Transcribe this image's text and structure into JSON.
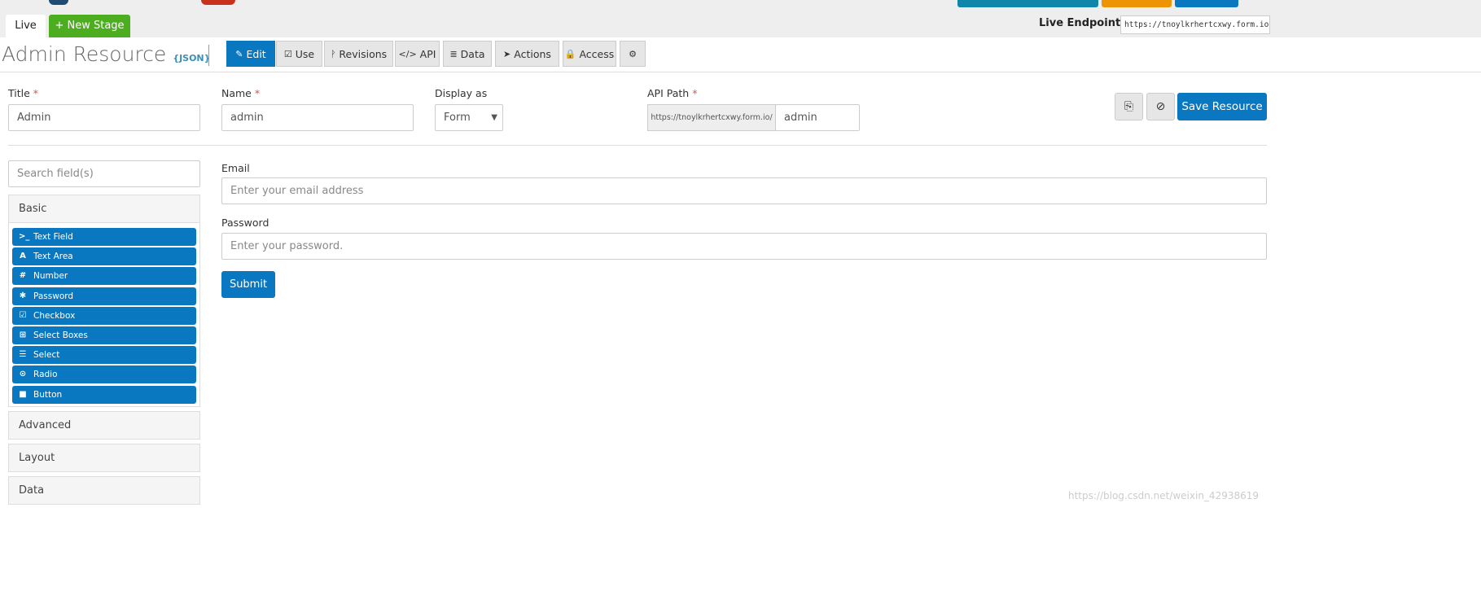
{
  "stage_tabs": {
    "live": "Live",
    "new_stage": "+ New Stage"
  },
  "endpoint": {
    "label": "Live Endpoint:",
    "value": "https://tnoylkrhertcxwy.form.io"
  },
  "header": {
    "title": "Admin Resource",
    "json_badge": "{JSON}"
  },
  "nav": [
    {
      "label": "Edit",
      "icon": "edit-icon",
      "glyph": "✎"
    },
    {
      "label": "Use",
      "icon": "check-square-icon",
      "glyph": "☑"
    },
    {
      "label": "Revisions",
      "icon": "branch-icon",
      "glyph": "ᚹ"
    },
    {
      "label": "API",
      "icon": "code-icon",
      "glyph": "</>"
    },
    {
      "label": "Data",
      "icon": "database-icon",
      "glyph": "≣"
    },
    {
      "label": "Actions",
      "icon": "paper-plane-icon",
      "glyph": "➤"
    },
    {
      "label": "Access",
      "icon": "lock-icon",
      "glyph": "🔒"
    },
    {
      "label": "",
      "icon": "gear-icon",
      "glyph": "⚙"
    }
  ],
  "settings": {
    "title": {
      "label": "Title",
      "value": "Admin"
    },
    "name": {
      "label": "Name",
      "value": "admin"
    },
    "display": {
      "label": "Display as",
      "value": "Form"
    },
    "api_path": {
      "label": "API Path",
      "prefix": "https://tnoylkrhertcxwy.form.io/",
      "value": "admin"
    },
    "required_mark": "*",
    "save_label": "Save Resource"
  },
  "sidebar": {
    "search_placeholder": "Search field(s)",
    "groups": [
      "Basic",
      "Advanced",
      "Layout",
      "Data"
    ],
    "basic_components": [
      {
        "label": "Text Field",
        "icon": "terminal-icon",
        "glyph": ">_"
      },
      {
        "label": "Text Area",
        "icon": "font-icon",
        "glyph": "A"
      },
      {
        "label": "Number",
        "icon": "hashtag-icon",
        "glyph": "#"
      },
      {
        "label": "Password",
        "icon": "asterisk-icon",
        "glyph": "✱"
      },
      {
        "label": "Checkbox",
        "icon": "check-square-icon",
        "glyph": "☑"
      },
      {
        "label": "Select Boxes",
        "icon": "plus-square-icon",
        "glyph": "⊞"
      },
      {
        "label": "Select",
        "icon": "list-icon",
        "glyph": "☰"
      },
      {
        "label": "Radio",
        "icon": "dot-circle-icon",
        "glyph": "⊙"
      },
      {
        "label": "Button",
        "icon": "stop-icon",
        "glyph": "■"
      }
    ]
  },
  "form": {
    "email": {
      "label": "Email",
      "placeholder": "Enter your email address"
    },
    "password": {
      "label": "Password",
      "placeholder": "Enter your password."
    },
    "submit": "Submit"
  },
  "watermark": "https://blog.csdn.net/weixin_42938619",
  "colors": {
    "primary": "#0a78c1",
    "success": "#4cae1e",
    "topbar": "#eeeeee"
  }
}
